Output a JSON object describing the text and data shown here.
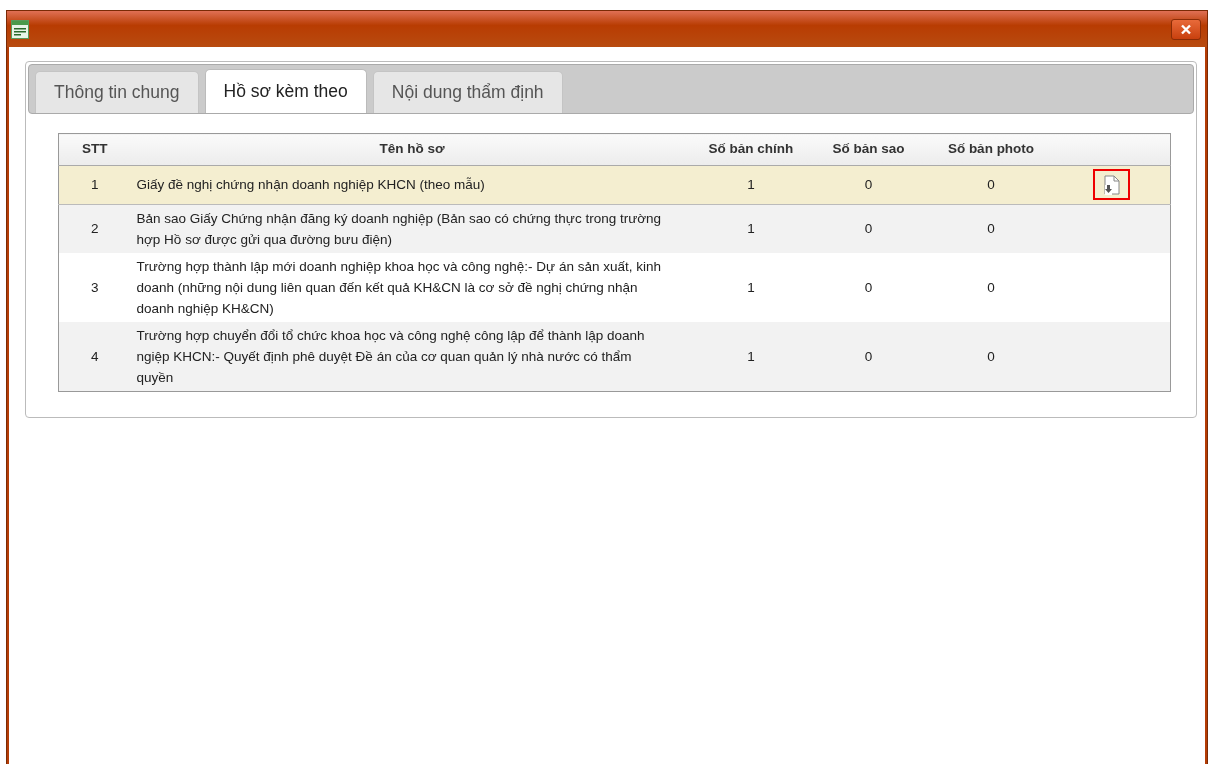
{
  "tabs": [
    {
      "label": "Thông tin chung",
      "selected": false
    },
    {
      "label": "Hồ sơ kèm theo",
      "selected": true
    },
    {
      "label": "Nội dung thẩm định",
      "selected": false
    }
  ],
  "table": {
    "columns": [
      "STT",
      "Tên hồ sơ",
      "Số bản chính",
      "Số bản sao",
      "Số bản photo"
    ],
    "rows": [
      {
        "stt": "1",
        "name": "Giấy đề nghị chứng nhận doanh nghiệp KHCN (theo mẫu)",
        "originals": "1",
        "copies": "0",
        "photos": "0",
        "selected": true,
        "download": true
      },
      {
        "stt": "2",
        "name": "Bản sao Giấy Chứng nhận đăng ký doanh nghiệp (Bản sao có chứng thực trong trường hợp Hồ sơ được gửi qua đường bưu điện)",
        "originals": "1",
        "copies": "0",
        "photos": "0",
        "selected": false,
        "download": false
      },
      {
        "stt": "3",
        "name": "Trường hợp thành lập mới doanh nghiệp khoa học và công nghệ:- Dự án sản xuất, kinh doanh (những nội dung liên quan đến kết quả KH&CN là cơ sở đề nghị chứng nhận doanh nghiệp KH&CN)",
        "originals": "1",
        "copies": "0",
        "photos": "0",
        "selected": false,
        "download": false
      },
      {
        "stt": "4",
        "name": "Trường hợp chuyển đổi tổ chức khoa học và công nghệ công lập để thành lập doanh ngiệp KHCN:- Quyết định phê duyệt Đề án của cơ quan quản lý nhà nước có thẩm quyền",
        "originals": "1",
        "copies": "0",
        "photos": "0",
        "selected": false,
        "download": false
      }
    ]
  }
}
